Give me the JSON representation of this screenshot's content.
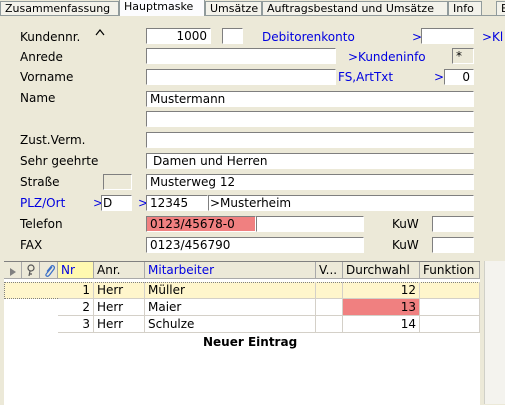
{
  "tabs": [
    "Zusammenfassung",
    "Hauptmaske",
    "Umsätze",
    "Auftragsbestand und Umsätze",
    "Info",
    "E"
  ],
  "form": {
    "kundennr_label": "Kundennr.",
    "kundennr_value": "1000",
    "debitor_label": "Debitorenkonto",
    "debitor_arrow": ">",
    "kl_label": ">Kl",
    "anrede_label": "Anrede",
    "kundeninfo_label": ">Kundeninfo",
    "kundeninfo_value": "*",
    "vorname_label": "Vorname",
    "fs_label": "FS,ArtTxt",
    "fs_arrow": ">",
    "fs_value": "0",
    "name_label": "Name",
    "name_value": "Mustermann",
    "zust_label": "Zust.Verm.",
    "sehr_label": "Sehr geehrte",
    "sehr_value": "Damen und Herren",
    "strasse_label": "Straße",
    "strasse_value": "Musterweg 12",
    "plz_label": "PLZ/Ort",
    "plz_arrow1": ">",
    "plz_land": "D",
    "plz_arrow2": ">",
    "plz_value": "12345",
    "ort_value": ">Musterheim",
    "telefon_label": "Telefon",
    "telefon_value": "0123/45678-0",
    "kuw_label1": "KuW",
    "fax_label": "FAX",
    "fax_value": "0123/456790",
    "kuw_label2": "KuW"
  },
  "grid": {
    "headers": [
      "Nr",
      "Anr.",
      "Mitarbeiter",
      "V...",
      "Durchwahl",
      "Funktion"
    ],
    "rows": [
      {
        "nr": "1",
        "anr": "Herr",
        "name": "Müller",
        "durchwahl": "12"
      },
      {
        "nr": "2",
        "anr": "Herr",
        "name": "Maier",
        "durchwahl": "13"
      },
      {
        "nr": "3",
        "anr": "Herr",
        "name": "Schulze",
        "durchwahl": "14"
      }
    ],
    "new_entry": "Neuer Eintrag"
  },
  "colors": {
    "highlight_red": "#f08080",
    "link_blue": "#0000e0",
    "selected_row": "#fff6cc"
  }
}
